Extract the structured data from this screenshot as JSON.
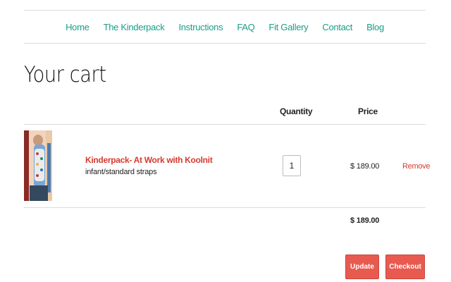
{
  "nav": {
    "items": [
      "Home",
      "The Kinderpack",
      "Instructions",
      "FAQ",
      "Fit Gallery",
      "Contact",
      "Blog"
    ]
  },
  "page": {
    "title": "Your cart"
  },
  "table": {
    "headers": {
      "quantity": "Quantity",
      "price": "Price"
    }
  },
  "cart_items": [
    {
      "name": "Kinderpack- At Work with Koolnit",
      "variant": "infant/standard straps",
      "quantity": "1",
      "price": "$ 189.00",
      "remove_label": "Remove"
    }
  ],
  "subtotal": "$ 189.00",
  "buttons": {
    "update": "Update",
    "checkout": "Checkout"
  },
  "colors": {
    "nav_link": "#1a9e8a",
    "accent_red": "#e85a4f",
    "product_link": "#d53a2f"
  }
}
